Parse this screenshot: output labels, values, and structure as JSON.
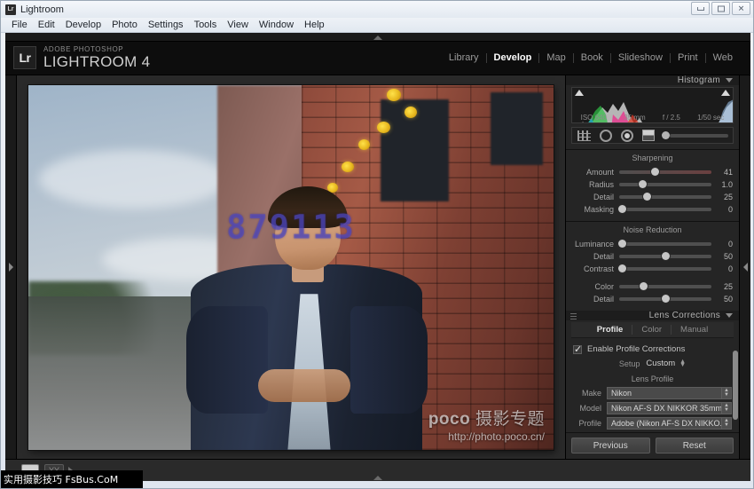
{
  "window": {
    "title": "Lightroom",
    "icon": "Lr",
    "minimize": "minimize-icon",
    "maximize": "maximize-icon",
    "close": "✕"
  },
  "menubar": [
    "File",
    "Edit",
    "Develop",
    "Photo",
    "Settings",
    "Tools",
    "View",
    "Window",
    "Help"
  ],
  "app": {
    "logo": "Lr",
    "brand_sup": "ADOBE PHOTOSHOP",
    "brand_main": "LIGHTROOM 4",
    "modules": [
      {
        "label": "Library",
        "active": false
      },
      {
        "label": "Develop",
        "active": true
      },
      {
        "label": "Map",
        "active": false
      },
      {
        "label": "Book",
        "active": false
      },
      {
        "label": "Slideshow",
        "active": false
      },
      {
        "label": "Print",
        "active": false
      },
      {
        "label": "Web",
        "active": false
      }
    ]
  },
  "photo": {
    "overlay_number": "879113",
    "watermark_brand": "poco",
    "watermark_cn": "摄影专题",
    "watermark_url": "http://photo.poco.cn/"
  },
  "histogram": {
    "title": "Histogram",
    "iso": "ISO 640",
    "focal": "35 mm",
    "aperture": "f / 2.5",
    "shutter": "1/50 sec"
  },
  "tools": [
    {
      "name": "crop-overlay-tool"
    },
    {
      "name": "spot-removal-tool"
    },
    {
      "name": "red-eye-tool"
    },
    {
      "name": "graduated-filter-tool"
    },
    {
      "name": "adjustment-brush-tool"
    }
  ],
  "detail": {
    "sharpening_title": "Sharpening",
    "sharpening": [
      {
        "label": "Amount",
        "value": "41",
        "pos": 38
      },
      {
        "label": "Radius",
        "value": "1.0",
        "pos": 25
      },
      {
        "label": "Detail",
        "value": "25",
        "pos": 30
      },
      {
        "label": "Masking",
        "value": "0",
        "pos": 3
      }
    ],
    "noise_title": "Noise Reduction",
    "noise": [
      {
        "label": "Luminance",
        "value": "0",
        "pos": 3
      },
      {
        "label": "Detail",
        "value": "50",
        "pos": 50
      },
      {
        "label": "Contrast",
        "value": "0",
        "pos": 3
      }
    ],
    "color": [
      {
        "label": "Color",
        "value": "25",
        "pos": 26
      },
      {
        "label": "Detail",
        "value": "50",
        "pos": 50
      }
    ]
  },
  "lens": {
    "title": "Lens Corrections",
    "tabs": [
      {
        "label": "Profile",
        "active": true
      },
      {
        "label": "Color",
        "active": false
      },
      {
        "label": "Manual",
        "active": false
      }
    ],
    "enable_label": "Enable Profile Corrections",
    "setup_label": "Setup",
    "setup_value": "Custom",
    "profile_title": "Lens Profile",
    "fields": [
      {
        "label": "Make",
        "value": "Nikon"
      },
      {
        "label": "Model",
        "value": "Nikon AF-S DX NIKKOR 35mm..."
      },
      {
        "label": "Profile",
        "value": "Adobe (Nikon AF-S DX NIKKO..."
      }
    ]
  },
  "footer": {
    "previous": "Previous",
    "reset": "Reset"
  },
  "toolbar": {
    "loupe_view": "loupe-view-icon",
    "compare": "YY"
  },
  "taskbar": {
    "text": "实用摄影技巧 FsBus.CoM"
  }
}
